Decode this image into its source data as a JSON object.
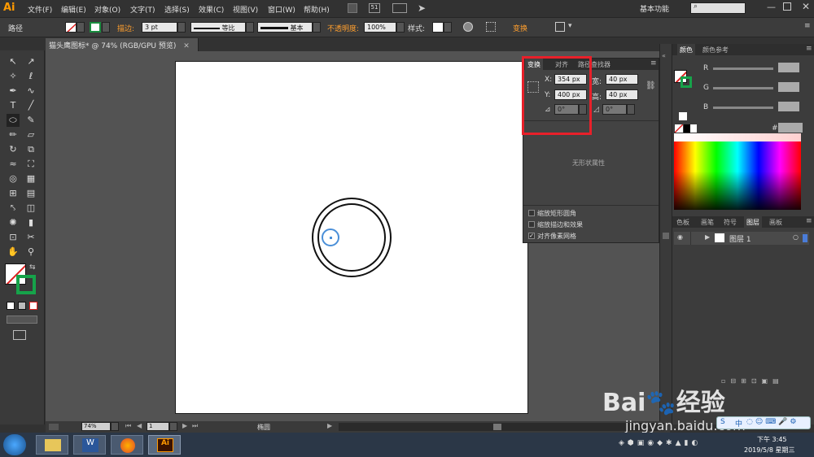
{
  "app": {
    "logo": "Ai"
  },
  "menu": [
    "文件(F)",
    "编辑(E)",
    "对象(O)",
    "文字(T)",
    "选择(S)",
    "效果(C)",
    "视图(V)",
    "窗口(W)",
    "帮助(H)"
  ],
  "topright": {
    "workspace": "基本功能",
    "counter": "51"
  },
  "control": {
    "path_label": "路径",
    "stroke_label": "描边:",
    "stroke_value": "3 pt",
    "profile1": "等比",
    "profile2": "基本",
    "opacity_label": "不透明度:",
    "opacity_value": "100%",
    "style_label": "样式:",
    "transform_label": "变换"
  },
  "document": {
    "tab": "猫头鹰图标* @ 74% (RGB/GPU 预览)",
    "zoom": "74%",
    "page": "1",
    "status": "椭圆"
  },
  "transform_panel": {
    "tabs": [
      "变换",
      "对齐",
      "路径查找器"
    ],
    "x_label": "X:",
    "x_value": "354 px",
    "y_label": "Y:",
    "y_value": "400 px",
    "w_label": "宽:",
    "w_value": "40 px",
    "h_label": "高:",
    "h_value": "40 px",
    "angle": "0°",
    "shear": "0°",
    "no_shape": "无形状属性",
    "options": [
      {
        "label": "缩放矩形圆角",
        "checked": false
      },
      {
        "label": "缩放描边和效果",
        "checked": false
      },
      {
        "label": "对齐像素网格",
        "checked": true
      }
    ]
  },
  "color_panel": {
    "tabs": [
      "颜色",
      "颜色参考"
    ],
    "channels": [
      "R",
      "G",
      "B"
    ],
    "hex_label": "#"
  },
  "layers_panel": {
    "tabs": [
      "色板",
      "画笔",
      "符号",
      "图层",
      "画板"
    ],
    "layer_name": "图层 1"
  },
  "taskbar": {
    "time": "下午 3:45",
    "date": "2019/5/8 星期三"
  },
  "watermark": {
    "brand": "Bai",
    "brand2": "经验",
    "url": "jingyan.baidu.com",
    "ime": "中"
  }
}
